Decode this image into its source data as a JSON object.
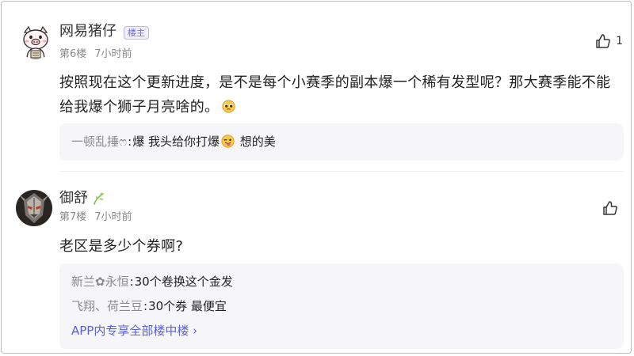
{
  "posts": [
    {
      "username": "网易猪仔",
      "badge": "楼主",
      "floor": "第6楼",
      "time": "7小时前",
      "likes": "1",
      "content": "按照现在这个更新进度，是不是每个小赛季的副本爆一个稀有发型呢？那大赛季能不能给我爆个狮子月亮啥的。",
      "replies": [
        {
          "author": "一顿乱捶ෆ",
          "sep": ":",
          "text_before": "爆 我头给你打爆",
          "emoji": "face-tongue-icon",
          "text_after": " 想的美"
        }
      ]
    },
    {
      "username": "御舒",
      "badge_icon": "leaf-icon",
      "floor": "第7楼",
      "time": "7小时前",
      "likes": "",
      "content": "老区是多少个券啊?",
      "replies": [
        {
          "author": "新兰✿永恒",
          "sep": ":",
          "text": "30个卷换这个金发"
        },
        {
          "author": "飞翔、荷兰豆",
          "sep": ":",
          "text": "30个券 最便宜"
        }
      ],
      "more_link": "APP内专享全部楼中楼 ›"
    }
  ],
  "colors": {
    "accent": "#5a5fd6",
    "badge_text": "#6f6bd8",
    "meta": "#8a8a8a",
    "reply_bg": "#f6f6f8",
    "leaf": "#7cc046"
  }
}
